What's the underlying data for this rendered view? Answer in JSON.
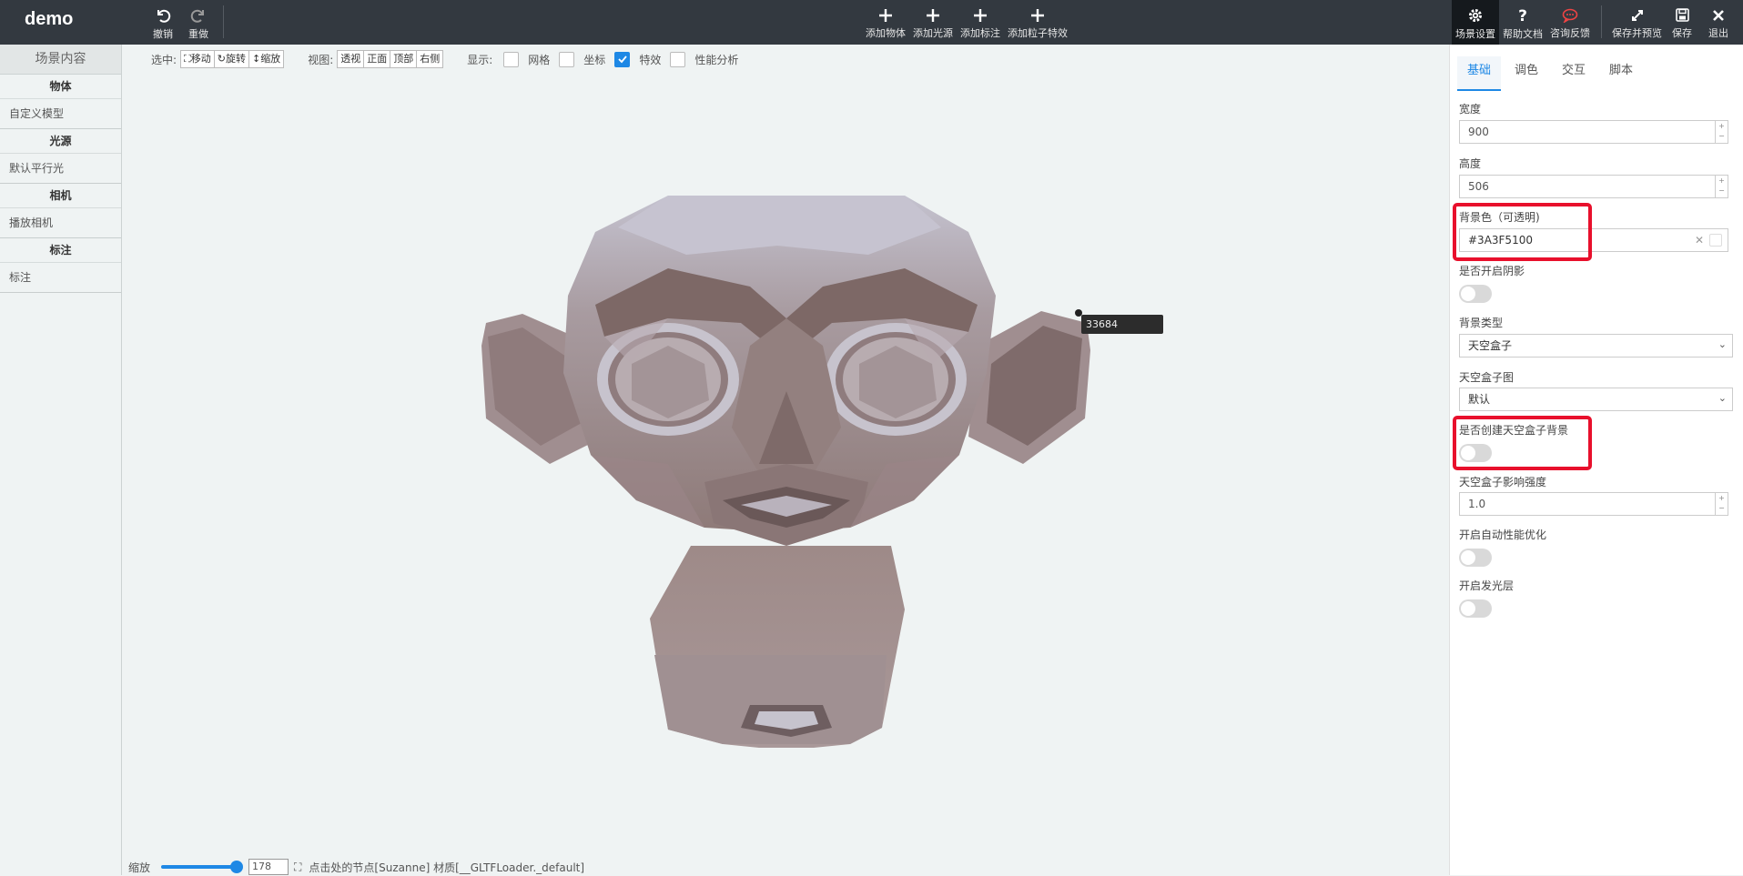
{
  "app": {
    "title": "demo"
  },
  "toolbar": {
    "undo": "撤销",
    "redo": "重做",
    "add_object": "添加物体",
    "add_light": "添加光源",
    "add_annotation": "添加标注",
    "add_particle": "添加粒子特效",
    "scene_settings": "场景设置",
    "help_docs": "帮助文档",
    "feedback": "咨询反馈",
    "save_preview": "保存并预览",
    "save": "保存",
    "exit": "退出"
  },
  "left_panel": {
    "title": "场景内容",
    "sections": [
      {
        "header": "物体",
        "item": "自定义模型"
      },
      {
        "header": "光源",
        "item": "默认平行光"
      },
      {
        "header": "相机",
        "item": "播放相机"
      },
      {
        "header": "标注",
        "item": "标注"
      }
    ]
  },
  "view_tools": {
    "select_label": "选中:",
    "move": "移动",
    "rotate": "旋转",
    "scale": "缩放",
    "view_label": "视图:",
    "views": [
      "透视",
      "正面",
      "顶部",
      "右侧"
    ],
    "display_label": "显示:",
    "grid": "网格",
    "axes": "坐标",
    "effects": "特效",
    "perf": "性能分析"
  },
  "viewport": {
    "tag_value": "33684"
  },
  "bottom_bar": {
    "zoom_label": "缩放",
    "zoom_value": "178",
    "status": "点击处的节点[Suzanne] 材质[__GLTFLoader._default]"
  },
  "right_panel": {
    "tabs": [
      "基础",
      "调色",
      "交互",
      "脚本"
    ],
    "width_label": "宽度",
    "width_value": "900",
    "height_label": "高度",
    "height_value": "506",
    "bg_color_label": "背景色（可透明)",
    "bg_color_value": "#3A3F5100",
    "shadow_label": "是否开启阴影",
    "bg_type_label": "背景类型",
    "bg_type_value": "天空盒子",
    "skybox_label": "天空盒子图",
    "skybox_value": "默认",
    "skybox_bg_label": "是否创建天空盒子背景",
    "skybox_intensity_label": "天空盒子影响强度",
    "skybox_intensity_value": "1.0",
    "auto_perf_label": "开启自动性能优化",
    "glow_label": "开启发光层"
  },
  "colors": {
    "accent": "#1e88e5",
    "highlight": "#e8102c",
    "topbar": "#333940"
  }
}
